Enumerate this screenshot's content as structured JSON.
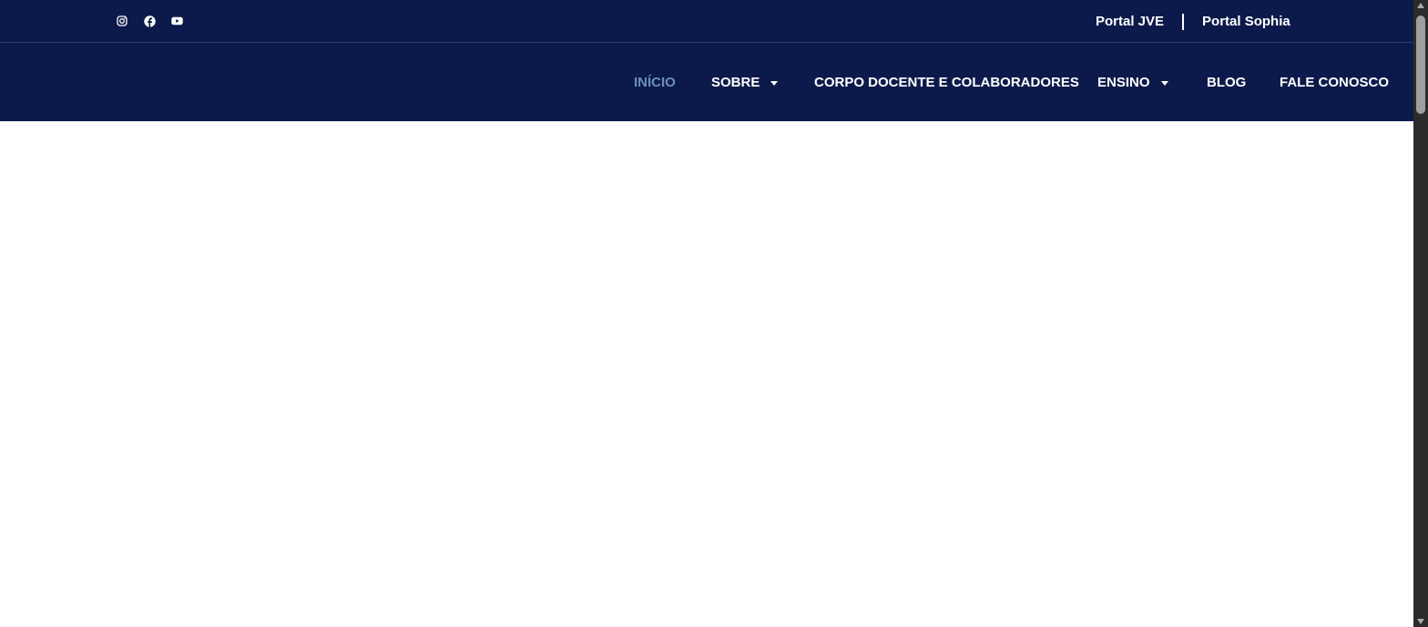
{
  "topbar": {
    "social_icons": [
      "instagram-icon",
      "facebook-icon",
      "youtube-icon"
    ],
    "portals": {
      "first": "Portal JVE",
      "second": "Portal Sophia"
    }
  },
  "nav": {
    "items": [
      {
        "label": "INÍCIO",
        "active": true,
        "dropdown": false
      },
      {
        "label": "SOBRE",
        "active": false,
        "dropdown": true
      },
      {
        "label": "CORPO DOCENTE E COLABORADORES",
        "active": false,
        "dropdown": false
      },
      {
        "label": "ENSINO",
        "active": false,
        "dropdown": true
      },
      {
        "label": "BLOG",
        "active": false,
        "dropdown": false
      },
      {
        "label": "FALE CONOSCO",
        "active": false,
        "dropdown": false
      }
    ]
  },
  "colors": {
    "header_bg": "#0c1a4b",
    "active_link": "#6c8fb5",
    "link": "#ffffff",
    "page_bg": "#ffffff",
    "scrollbar_track": "#2b2b2b",
    "scrollbar_thumb": "#9f9f9f"
  }
}
